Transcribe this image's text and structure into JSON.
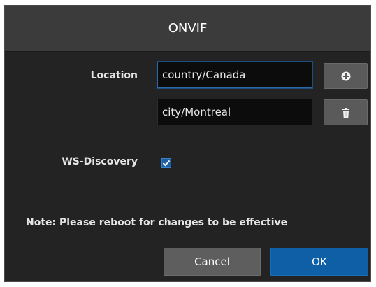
{
  "dialog": {
    "title": "ONVIF"
  },
  "location": {
    "label": "Location",
    "entries": [
      {
        "value": "country/Canada",
        "focused": true
      },
      {
        "value": "city/Montreal",
        "focused": false
      }
    ],
    "add_icon": "plus-circle-icon",
    "delete_icon": "trash-icon"
  },
  "ws_discovery": {
    "label": "WS-Discovery",
    "checked": true
  },
  "note": "Note: Please reboot for changes to be effective",
  "buttons": {
    "cancel": "Cancel",
    "ok": "OK"
  },
  "colors": {
    "dialog_bg": "#232323",
    "titlebar_bg": "#3b3b3b",
    "accent": "#0e5fa6",
    "button_gray": "#5e5e5e"
  }
}
